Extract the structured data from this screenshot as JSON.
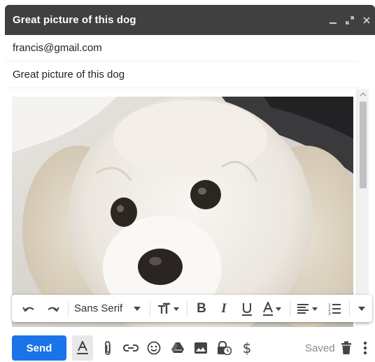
{
  "window": {
    "title": "Great picture of this dog",
    "controls": [
      "minimize-icon",
      "fullscreen-icon",
      "close-icon"
    ]
  },
  "compose": {
    "to": "francis@gmail.com",
    "subject": "Great picture of this dog",
    "attachment_image": "inline photo of a white fluffy dog"
  },
  "format_toolbar": {
    "font_family": "Sans Serif",
    "items": [
      "undo-icon",
      "redo-icon",
      "font-family-select",
      "font-size-icon",
      "bold-icon",
      "italic-icon",
      "underline-icon",
      "text-color-icon",
      "align-icon",
      "numbered-list-icon",
      "more-formatting-icon"
    ]
  },
  "actions": {
    "send_label": "Send",
    "saved_label": "Saved",
    "items": [
      "formatting-options-icon",
      "attach-file-icon",
      "insert-link-icon",
      "insert-emoji-icon",
      "google-drive-icon",
      "insert-photo-icon",
      "confidential-mode-icon",
      "send-money-icon",
      "discard-draft-icon",
      "more-options-icon"
    ]
  },
  "colors": {
    "titlebar": "#404040",
    "send_button": "#1a73e8",
    "icon": "#444444"
  }
}
